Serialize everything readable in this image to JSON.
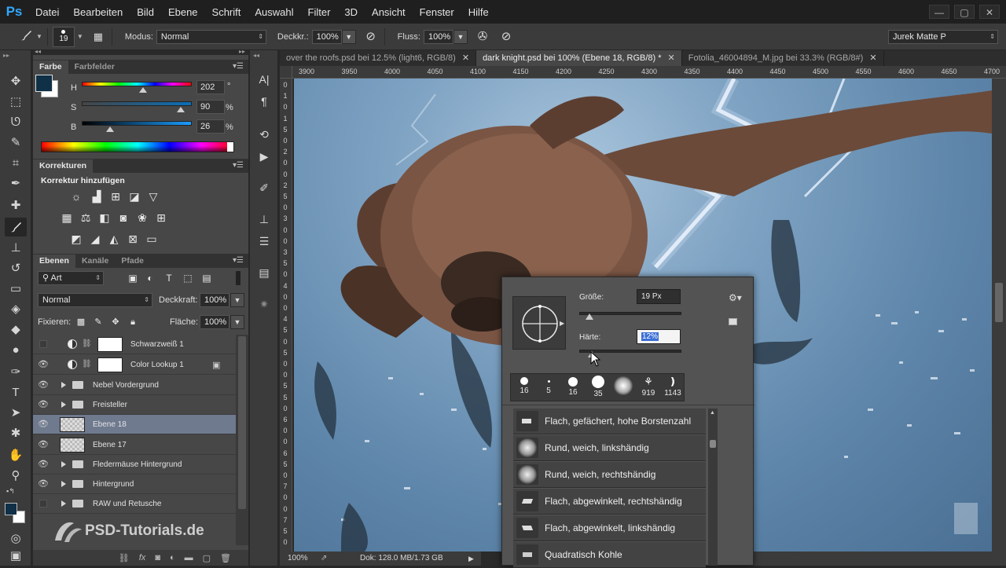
{
  "app": {
    "logo": "Ps",
    "menu": [
      "Datei",
      "Bearbeiten",
      "Bild",
      "Ebene",
      "Schrift",
      "Auswahl",
      "Filter",
      "3D",
      "Ansicht",
      "Fenster",
      "Hilfe"
    ],
    "window_buttons": [
      "—",
      "▢",
      "✕"
    ]
  },
  "options": {
    "brush_size": "19",
    "mode_label": "Modus:",
    "mode_value": "Normal",
    "opacity_label": "Deckkr.:",
    "opacity_value": "100%",
    "flow_label": "Fluss:",
    "flow_value": "100%",
    "workspace": "Jurek Matte P"
  },
  "color_panel": {
    "tabs": [
      "Farbe",
      "Farbfelder"
    ],
    "h_label": "H",
    "h_value": "202",
    "h_unit": "°",
    "h_pos": 0.56,
    "s_label": "S",
    "s_value": "90",
    "s_unit": "%",
    "s_pos": 0.9,
    "b_label": "B",
    "b_value": "26",
    "b_unit": "%",
    "b_pos": 0.26,
    "foreground": "#0f3047",
    "background": "#ffffff"
  },
  "adjustments_panel": {
    "tab": "Korrekturen",
    "heading": "Korrektur hinzufügen",
    "row1_icons": [
      "brightness-icon",
      "levels-icon",
      "curves-icon",
      "exposure-icon",
      "vibrance-icon"
    ],
    "row2_icons": [
      "hue-sat-icon",
      "color-balance-icon",
      "black-white-icon",
      "photo-filter-icon",
      "channel-mixer-icon",
      "color-lookup-icon"
    ],
    "row3_icons": [
      "invert-icon",
      "posterize-icon",
      "threshold-icon",
      "selective-color-icon",
      "gradient-map-icon"
    ]
  },
  "layers_panel": {
    "tabs": [
      "Ebenen",
      "Kanäle",
      "Pfade"
    ],
    "filter_kind": "Art",
    "blend_mode": "Normal",
    "opacity_label": "Deckkraft:",
    "opacity_value": "100%",
    "lock_label": "Fixieren:",
    "fill_label": "Fläche:",
    "fill_value": "100%",
    "layers": [
      {
        "name": "Schwarzweiß 1",
        "type": "adjustment",
        "visible": false
      },
      {
        "name": "Color Lookup 1",
        "type": "adjustment",
        "visible": true
      },
      {
        "name": "Nebel Vordergrund",
        "type": "group",
        "visible": true
      },
      {
        "name": "Freisteller",
        "type": "group",
        "visible": true
      },
      {
        "name": "Ebene 18",
        "type": "pixel",
        "visible": true,
        "selected": true
      },
      {
        "name": "Ebene 17",
        "type": "pixel",
        "visible": true
      },
      {
        "name": "Fledermäuse Hintergrund",
        "type": "group",
        "visible": true
      },
      {
        "name": "Hintergrund",
        "type": "group",
        "visible": true
      },
      {
        "name": "RAW und Retusche",
        "type": "group",
        "visible": false
      }
    ]
  },
  "documents": {
    "tabs": [
      {
        "label": "over the roofs.psd bei 12.5% (light6, RGB/8)",
        "active": false
      },
      {
        "label": "dark knight.psd bei 100% (Ebene 18, RGB/8) *",
        "active": true
      },
      {
        "label": "Fotolia_46004894_M.jpg bei 33.3% (RGB/8#)",
        "active": false
      }
    ],
    "close_glyph": "✕"
  },
  "ruler": {
    "h_ticks": [
      "3900",
      "3950",
      "4000",
      "4050",
      "4100",
      "4150",
      "4200",
      "4250",
      "4300",
      "4350",
      "4400",
      "4450",
      "4500",
      "4550",
      "4600",
      "4650",
      "4700"
    ],
    "v_ticks": [
      "0",
      "1",
      "0",
      "1",
      "5",
      "0",
      "2",
      "0",
      "0",
      "2",
      "5",
      "0",
      "3",
      "0",
      "0",
      "3",
      "5",
      "0",
      "4",
      "0",
      "0",
      "4",
      "5",
      "0",
      "5",
      "0",
      "0",
      "5",
      "5",
      "0",
      "6",
      "0",
      "0",
      "6",
      "5",
      "0",
      "7",
      "0",
      "0",
      "7",
      "5",
      "0"
    ]
  },
  "status": {
    "zoom": "100%",
    "doc_size": "Dok: 128.0 MB/1.73 GB"
  },
  "brush_popup": {
    "size_label": "Größe:",
    "size_value": "19 Px",
    "size_pos": 0.1,
    "hardness_label": "Härte:",
    "hardness_value": "12%",
    "hardness_pos": 0.12,
    "presets": [
      "16",
      "5",
      "16",
      "35",
      "",
      "919",
      "1143"
    ],
    "brushes": [
      "Flach, gefächert, hohe Borstenzahl",
      "Rund, weich, linkshändig",
      "Rund, weich, rechtshändig",
      "Flach, abgewinkelt, rechtshändig",
      "Flach, abgewinkelt, linkshändig",
      "Quadratisch Kohle"
    ]
  },
  "watermark": "PSD-Tutorials.de"
}
